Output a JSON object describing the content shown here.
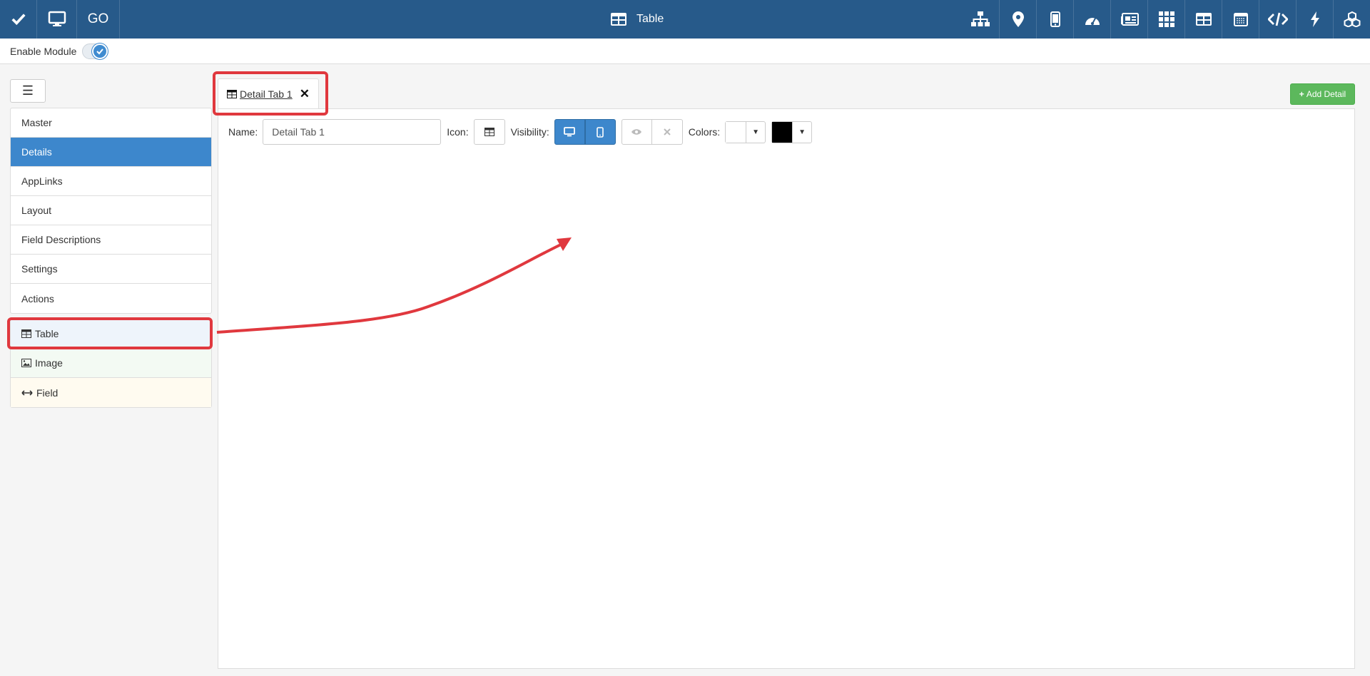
{
  "topbar": {
    "go_label": "GO",
    "title": "Table",
    "left_icons": [
      "check-icon",
      "monitor-icon"
    ],
    "right_icons": [
      "sitemap-icon",
      "map-marker-icon",
      "mobile-icon",
      "dashboard-icon",
      "newspaper-icon",
      "grid-icon",
      "table-icon",
      "calendar-icon",
      "code-icon",
      "bolt-icon",
      "cubes-icon"
    ],
    "color": "#275a8a"
  },
  "module": {
    "label": "Enable Module",
    "enabled": true
  },
  "sidebar": {
    "menu": [
      {
        "label": "Master"
      },
      {
        "label": "Details"
      },
      {
        "label": "AppLinks"
      },
      {
        "label": "Layout"
      },
      {
        "label": "Field Descriptions"
      },
      {
        "label": "Settings"
      },
      {
        "label": "Actions"
      }
    ],
    "active_item": "Details",
    "tools": [
      {
        "label": "Table",
        "icon": "table-icon"
      },
      {
        "label": "Image",
        "icon": "image-icon"
      },
      {
        "label": "Field",
        "icon": "arrows-h-icon"
      }
    ]
  },
  "main": {
    "tab": {
      "label": "Detail Tab 1",
      "icon": "table-icon"
    },
    "add_detail_label": "Add Detail",
    "name_label": "Name:",
    "name_value": "Detail Tab 1",
    "name_placeholder": "Name",
    "icon_label": "Icon:",
    "visibility_label": "Visibility:",
    "colors_label": "Colors:",
    "bg_color": "#ffffff",
    "fg_color": "#000000"
  },
  "colors": {
    "accent": "#3d87cc",
    "success": "#5cb85c",
    "highlight": "#e0383e"
  }
}
